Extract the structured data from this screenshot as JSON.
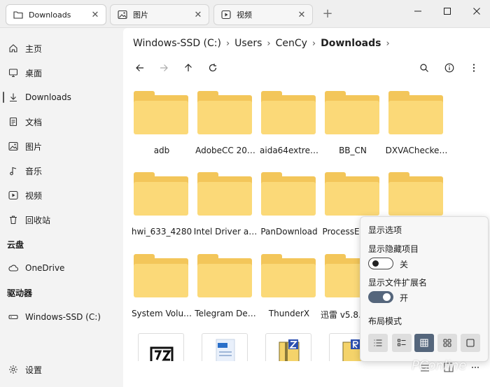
{
  "tabs": [
    {
      "label": "Downloads",
      "icon": "folder-icon",
      "active": true
    },
    {
      "label": "图片",
      "icon": "image-icon",
      "active": false
    },
    {
      "label": "视频",
      "icon": "video-icon",
      "active": false
    }
  ],
  "tab_close": "✕",
  "tab_new": "+",
  "sidebar": {
    "items": [
      {
        "label": "主页",
        "icon": "home-icon"
      },
      {
        "label": "桌面",
        "icon": "desktop-icon"
      },
      {
        "label": "Downloads",
        "icon": "download-icon",
        "selected": true
      },
      {
        "label": "文档",
        "icon": "document-icon"
      },
      {
        "label": "图片",
        "icon": "image-icon"
      },
      {
        "label": "音乐",
        "icon": "music-icon"
      },
      {
        "label": "视频",
        "icon": "video-icon"
      },
      {
        "label": "回收站",
        "icon": "recycle-bin-icon"
      }
    ],
    "cloud_header": "云盘",
    "onedrive": "OneDrive",
    "drives_header": "驱动器",
    "drive": "Windows-SSD (C:)",
    "settings": "设置"
  },
  "breadcrumb": [
    "Windows-SSD (C:)",
    "Users",
    "CenCy",
    "Downloads"
  ],
  "breadcrumb_sep": "›",
  "folders": [
    "adb",
    "AdobeCC 20…",
    "aida64extre…",
    "BB_CN",
    "DXVAChecke…",
    "hwi_633_4280",
    "Intel Driver a…",
    "PanDownload",
    "ProcessE…",
    "",
    "System Volu…",
    "Telegram De…",
    "ThunderX",
    "迅雷 v5.8…",
    ""
  ],
  "view_options": {
    "title": "显示选项",
    "hidden_items_label": "显示隐藏项目",
    "hidden_items_state": "关",
    "hidden_items_on": false,
    "extensions_label": "显示文件扩展名",
    "extensions_state": "开",
    "extensions_on": true,
    "layout_label": "布局模式",
    "layouts": [
      "details-view-icon",
      "list-view-icon",
      "grid-view-icon",
      "tiles-view-icon",
      "large-icon-view-icon"
    ],
    "active_layout": 2
  },
  "watermark": "PConline",
  "colors": {
    "folder": "#f3c65a",
    "folder_front": "#fbd978",
    "toggle_on": "#55667c"
  }
}
